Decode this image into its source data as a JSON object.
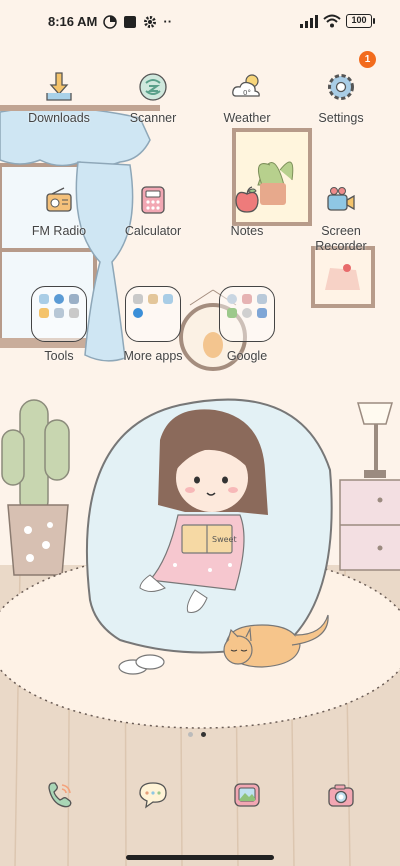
{
  "status_bar": {
    "time": "8:16 AM",
    "more": "··",
    "battery": "100"
  },
  "apps": {
    "downloads": "Downloads",
    "scanner": "Scanner",
    "weather": "Weather",
    "settings": "Settings",
    "settings_badge": "1",
    "fm_radio": "FM Radio",
    "calculator": "Calculator",
    "notes": "Notes",
    "screen_recorder_line1": "Screen",
    "screen_recorder_line2": "Recorder",
    "tools": "Tools",
    "more_apps": "More apps",
    "google": "Google"
  },
  "wallpaper": {
    "book_text": "Sweet"
  },
  "page_indicator": {
    "pages": 2,
    "active": 2
  },
  "dock": [
    "phone-icon",
    "messages-icon",
    "gallery-icon",
    "camera-icon"
  ],
  "colors": {
    "background": "#fdf3ea",
    "badge": "#f26b1d",
    "beanbag": "#e3f1f5",
    "rug": "#fef2e6"
  }
}
